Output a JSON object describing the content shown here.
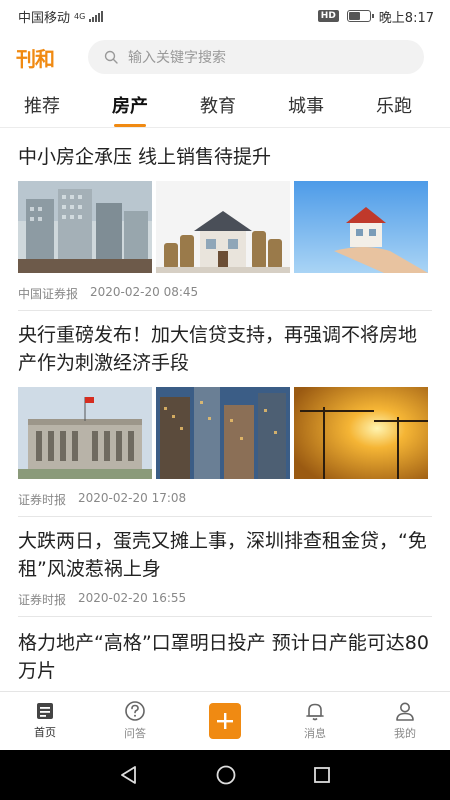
{
  "status_bar": {
    "carrier": "中国移动",
    "network": "4G",
    "hd": "HD",
    "time": "晚上8:17",
    "battery_level": 0.6
  },
  "header": {
    "logo": "刊和",
    "search_placeholder": "输入关键字搜索"
  },
  "tabs": [
    {
      "label": "推荐",
      "active": false
    },
    {
      "label": "房产",
      "active": true
    },
    {
      "label": "教育",
      "active": false
    },
    {
      "label": "城事",
      "active": false
    },
    {
      "label": "乐跑",
      "active": false
    }
  ],
  "articles": [
    {
      "title": "中小房企承压 线上销售待提升",
      "source": "中国证券报",
      "time": "2020-02-20 08:45",
      "thumbnails": [
        "buildings-construction-image",
        "house-on-coins-image",
        "house-in-hand-image"
      ]
    },
    {
      "title": "央行重磅发布！加大信贷支持，再强调不将房地产作为刺激经济手段",
      "source": "证券时报",
      "time": "2020-02-20 17:08",
      "thumbnails": [
        "central-bank-building-image",
        "city-towers-image",
        "cranes-sunset-image"
      ]
    },
    {
      "title": "大跌两日，蛋壳又摊上事，深圳排查租金贷，“免租”风波惹祸上身",
      "source": "证券时报",
      "time": "2020-02-20 16:55"
    },
    {
      "title": "格力地产“高格”口罩明日投产 预计日产能可达80万片"
    }
  ],
  "bottom_nav": [
    {
      "label": "首页",
      "icon": "home-icon",
      "active": true
    },
    {
      "label": "问答",
      "icon": "question-icon",
      "active": false
    },
    {
      "label": "",
      "icon": "plus-icon",
      "active": false
    },
    {
      "label": "消息",
      "icon": "bell-icon",
      "active": false
    },
    {
      "label": "我的",
      "icon": "user-icon",
      "active": false
    }
  ],
  "colors": {
    "accent": "#f08a12"
  }
}
